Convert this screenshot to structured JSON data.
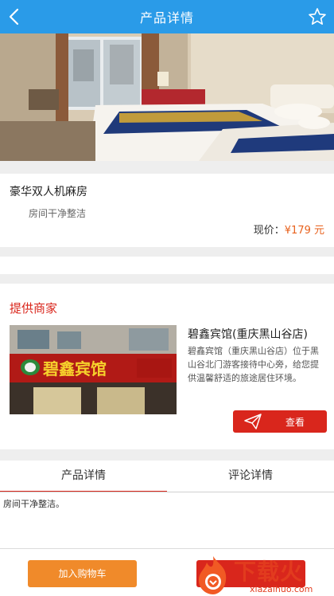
{
  "header": {
    "title": "产品详情",
    "back_icon": "back-arrow-icon",
    "favorite_icon": "star-outline-icon",
    "bg_color": "#2a9be8"
  },
  "product": {
    "name": "豪华双人机麻房",
    "description": "房间干净整洁",
    "price_label": "现价：",
    "price_value": "¥179 元"
  },
  "merchant": {
    "section_title": "提供商家",
    "name": "碧鑫宾馆(重庆黑山谷店)",
    "description": "碧鑫宾馆（重庆黑山谷店）位于黑山谷北门游客接待中心旁，给您提供温馨舒适的旅途居住环境。",
    "sign_text": "碧鑫宾馆",
    "view_label": "查看"
  },
  "tabs": [
    {
      "label": "产品详情",
      "active": true
    },
    {
      "label": "评论详情",
      "active": false
    }
  ],
  "detail_text": "房间干净整洁。",
  "bottom": {
    "cart_label": "加入购物车"
  },
  "watermark": {
    "brand": "下载火",
    "url": "xiazaihuo.com"
  },
  "colors": {
    "accent_red": "#d9261c",
    "price_orange": "#e8621e",
    "cart_orange": "#f08a2a"
  }
}
